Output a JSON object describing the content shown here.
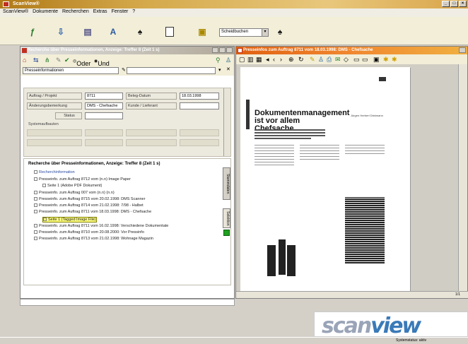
{
  "window": {
    "title": "ScanView®"
  },
  "menu": [
    "ScanView®",
    "Dokumente",
    "Recherchen",
    "Extras",
    "Fenster",
    "?"
  ],
  "toolbar": {
    "select_value": "Scheidbuchen"
  },
  "left_panel": {
    "title": "Recherche über Presseinformationen, Anzeige: Treffer 8 (Zeit 1 s)",
    "filter_and": "Oder",
    "filter_or": "Und",
    "combo_value": "Presseinformationen",
    "form": {
      "auftrag_label": "Auftrag / Projekt",
      "auftrag_value": "8711",
      "belegdatum_label": "Beleg-Datum",
      "belegdatum_value": "18.03.1998",
      "anderung_label": "Änderungsbemerkung",
      "anderung_value": "DMS - Chefsache",
      "kunde_label": "Kunde / Lieferant",
      "status_label": "Status",
      "system_label": "Systemaufbauten"
    },
    "tree_header": "Recherche über Presseinformationen, Anzeige: Treffer 8 (Zeit 1 s)",
    "tree_items": [
      "Recherchinformation",
      "Presseinfo. zum Auftrag 8712 vom (n.n) Image Paper",
      "Seite 1 (Adobe PDF Dokument)",
      "Presseinfo. zum Auftrag 007 vom (n.n) (n.n)",
      "Presseinfo. zum Auftrag 8715 vom 20.02.1998: DMS Scanner",
      "Presseinfo. zum Auftrag 8714 vom 21.02.1998: 7/98 - Halbet",
      "Presseinfo. zum Auftrag 8711 vom 18.03.1998: DMS - Chefsache",
      "Seite 1 (Tagged Image File)",
      "Presseinfo. zum Auftrag 8711 vom 16.02.1998: Verschiedene Dokumentate",
      "Presseinfo. zum Auftrag 8710 vom 20.08.2000: Vor Pressinfo",
      "Presseinfo. zum Auftrag 8713 vom 21.02.1998: Wohnage Magazin"
    ],
    "tab_label": "Stammdaten",
    "tab_label2": "Selektion"
  },
  "right_panel": {
    "title": "Presseinfos zum Auftrag 8711 vom 18.03.1998: DMS - Chefsache",
    "page_headline": "Dokumentenmanagement ist vor allem Chefsache",
    "page_author": "Jürgen Herbert Diekmann",
    "status_right": "1/1"
  },
  "logo": {
    "part1": "scan",
    "part2": "view"
  },
  "status": "Systemstatus: aktiv"
}
